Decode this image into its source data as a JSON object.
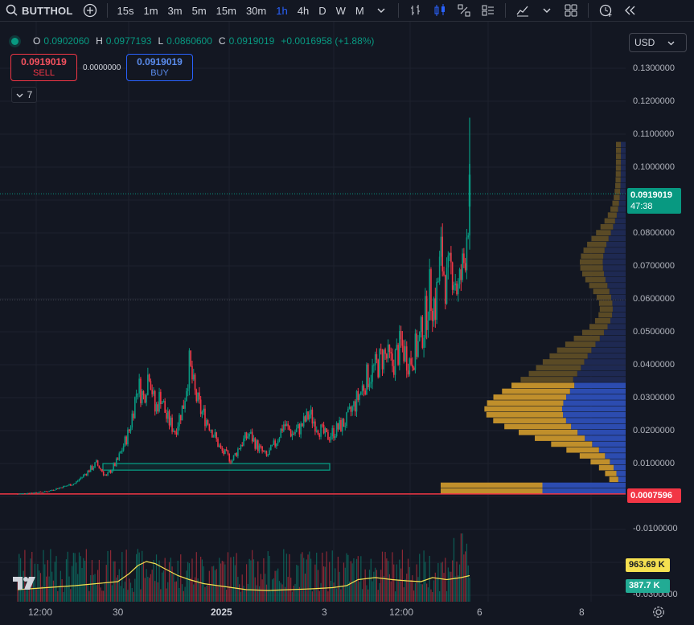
{
  "toolbar": {
    "symbol": "BUTTHOL",
    "intervals": [
      "15s",
      "1m",
      "3m",
      "5m",
      "15m",
      "30m",
      "1h",
      "4h",
      "D",
      "W",
      "M"
    ],
    "active_interval": "1h",
    "icons": [
      "search-icon",
      "add-symbol-icon",
      "chevron-down-icon",
      "bar-style-icon",
      "candles-icon",
      "line-style-icon",
      "columns-icon",
      "indicators-icon",
      "chevron-down-icon",
      "layout-icon",
      "replay-alert-icon",
      "replay-icon"
    ]
  },
  "legend": {
    "o_label": "O",
    "o": "0.0902060",
    "h_label": "H",
    "h": "0.0977193",
    "l_label": "L",
    "l": "0.0860600",
    "c_label": "C",
    "c": "0.0919019",
    "change": "+0.0016958 (+1.88%)"
  },
  "trade": {
    "sell_price": "0.0919019",
    "sell_label": "SELL",
    "spread": "0.0000000",
    "buy_price": "0.0919019",
    "buy_label": "BUY"
  },
  "indicators": {
    "count": "7"
  },
  "currency": "USD",
  "price_axis": [
    "0.1300000",
    "0.1200000",
    "0.1100000",
    "0.1000000",
    "0.0800000",
    "0.0700000",
    "0.0600000",
    "0.0500000",
    "0.0400000",
    "0.0300000",
    "0.0200000",
    "0.0100000",
    "-0.0100000",
    "-0.0300000"
  ],
  "tags": {
    "last_price": "0.0919019",
    "countdown": "47:38",
    "low_line": "0.0007596",
    "volume_ma": "963.69 K",
    "volume": "387.7 K"
  },
  "time_axis": [
    "12:00",
    "30",
    "2025",
    "3",
    "12:00",
    "6",
    "8"
  ],
  "colors": {
    "up": "#089981",
    "down": "#f23645",
    "accent": "#2962ff",
    "background": "#131722"
  },
  "chart_data": {
    "type": "candlestick",
    "series": [
      {
        "name": "BUTTHOL"
      }
    ],
    "x_ticks": [
      "12:00",
      "30",
      "2025",
      "3",
      "12:00",
      "6",
      "8"
    ],
    "y_range": [
      -0.03,
      0.135
    ],
    "close_path": [
      [
        0,
        0.0008
      ],
      [
        20,
        0.0015
      ],
      [
        40,
        0.004
      ],
      [
        55,
        0.01
      ],
      [
        62,
        0.006
      ],
      [
        70,
        0.011
      ],
      [
        78,
        0.02
      ],
      [
        84,
        0.034
      ],
      [
        88,
        0.03
      ],
      [
        92,
        0.039
      ],
      [
        96,
        0.026
      ],
      [
        100,
        0.031
      ],
      [
        104,
        0.024
      ],
      [
        110,
        0.02
      ],
      [
        116,
        0.028
      ],
      [
        120,
        0.04
      ],
      [
        124,
        0.031
      ],
      [
        128,
        0.026
      ],
      [
        134,
        0.022
      ],
      [
        142,
        0.014
      ],
      [
        150,
        0.011
      ],
      [
        156,
        0.016
      ],
      [
        162,
        0.019
      ],
      [
        168,
        0.015
      ],
      [
        174,
        0.012
      ],
      [
        180,
        0.016
      ],
      [
        186,
        0.022
      ],
      [
        192,
        0.019
      ],
      [
        198,
        0.021
      ],
      [
        204,
        0.025
      ],
      [
        210,
        0.021
      ],
      [
        216,
        0.018
      ],
      [
        222,
        0.02
      ],
      [
        230,
        0.023
      ],
      [
        238,
        0.03
      ],
      [
        244,
        0.036
      ],
      [
        250,
        0.039
      ],
      [
        256,
        0.043
      ],
      [
        262,
        0.04
      ],
      [
        268,
        0.046
      ],
      [
        274,
        0.041
      ],
      [
        280,
        0.046
      ],
      [
        284,
        0.052
      ],
      [
        288,
        0.062
      ],
      [
        292,
        0.058
      ],
      [
        296,
        0.073
      ],
      [
        300,
        0.064
      ],
      [
        304,
        0.07
      ],
      [
        308,
        0.062
      ],
      [
        312,
        0.071
      ],
      [
        316,
        0.092
      ]
    ],
    "volume_ma_path": [
      [
        0,
        0.3
      ],
      [
        20,
        0.35
      ],
      [
        40,
        0.4
      ],
      [
        55,
        0.45
      ],
      [
        70,
        0.5
      ],
      [
        78,
        0.7
      ],
      [
        84,
        0.9
      ],
      [
        90,
        1.0
      ],
      [
        96,
        0.95
      ],
      [
        104,
        0.8
      ],
      [
        112,
        0.65
      ],
      [
        120,
        0.55
      ],
      [
        130,
        0.45
      ],
      [
        140,
        0.4
      ],
      [
        150,
        0.35
      ],
      [
        160,
        0.3
      ],
      [
        175,
        0.28
      ],
      [
        190,
        0.3
      ],
      [
        205,
        0.32
      ],
      [
        220,
        0.35
      ],
      [
        230,
        0.4
      ],
      [
        238,
        0.55
      ],
      [
        250,
        0.6
      ],
      [
        262,
        0.55
      ],
      [
        272,
        0.52
      ],
      [
        282,
        0.5
      ],
      [
        290,
        0.6
      ],
      [
        300,
        0.55
      ],
      [
        310,
        0.6
      ],
      [
        316,
        0.65
      ]
    ],
    "support_zone": {
      "from": 0.008,
      "to": 0.01
    },
    "low_line": 0.0007596,
    "current_line": 0.0919019
  }
}
